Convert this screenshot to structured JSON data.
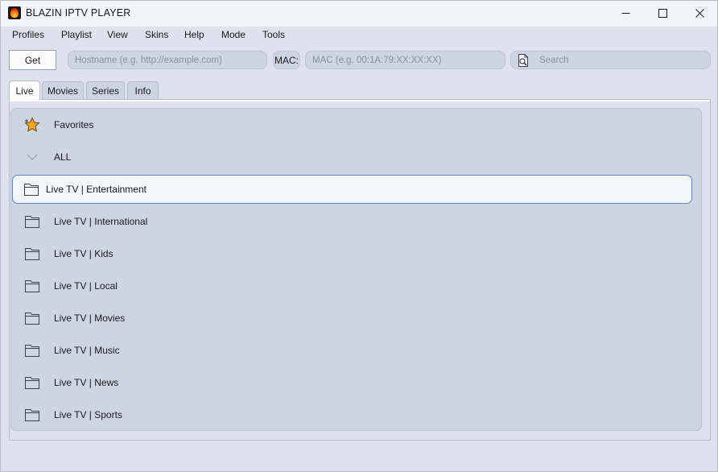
{
  "window": {
    "title": "BLAZIN IPTV PLAYER",
    "app_icon": "flame-logo-icon",
    "controls": [
      "minimize-icon",
      "maximize-icon",
      "close-icon"
    ]
  },
  "menubar": {
    "items": [
      {
        "label": "Profiles"
      },
      {
        "label": "Playlist"
      },
      {
        "label": "View"
      },
      {
        "label": "Skins"
      },
      {
        "label": "Help"
      },
      {
        "label": "Mode"
      },
      {
        "label": "Tools"
      }
    ]
  },
  "toolbar": {
    "get_label": "Get",
    "hostname": {
      "value": "",
      "placeholder": "Hostname (e.g. http://example.com)"
    },
    "mac_label": "MAC:",
    "mac": {
      "value": "",
      "placeholder": "MAC (e.g. 00:1A:79:XX:XX:XX)"
    },
    "search": {
      "value": "",
      "placeholder": "Search",
      "icon": "search-document-icon"
    }
  },
  "tabs": [
    {
      "label": "Live",
      "active": true
    },
    {
      "label": "Movies",
      "active": false
    },
    {
      "label": "Series",
      "active": false
    },
    {
      "label": "Info",
      "active": false
    }
  ],
  "categories": {
    "favorites": {
      "label": "Favorites",
      "icon": "star-icon"
    },
    "all": {
      "label": "ALL",
      "icon": "chevron-down-icon"
    },
    "items": [
      {
        "label": "Live TV | Entertainment",
        "icon": "folder-icon",
        "selected": true
      },
      {
        "label": "Live TV | International",
        "icon": "folder-icon",
        "selected": false
      },
      {
        "label": "Live TV | Kids",
        "icon": "folder-icon",
        "selected": false
      },
      {
        "label": "Live TV | Local",
        "icon": "folder-icon",
        "selected": false
      },
      {
        "label": "Live TV | Movies",
        "icon": "folder-icon",
        "selected": false
      },
      {
        "label": "Live TV | Music",
        "icon": "folder-icon",
        "selected": false
      },
      {
        "label": "Live TV | News",
        "icon": "folder-icon",
        "selected": false
      },
      {
        "label": "Live TV | Sports",
        "icon": "folder-icon",
        "selected": false
      }
    ]
  },
  "colors": {
    "window_bg": "#dde2ec",
    "panel_bg": "#cdd4e2",
    "selection_border": "#5f84c4",
    "selection_bg": "#f3f6fb",
    "star_fill": "#f5a623"
  }
}
